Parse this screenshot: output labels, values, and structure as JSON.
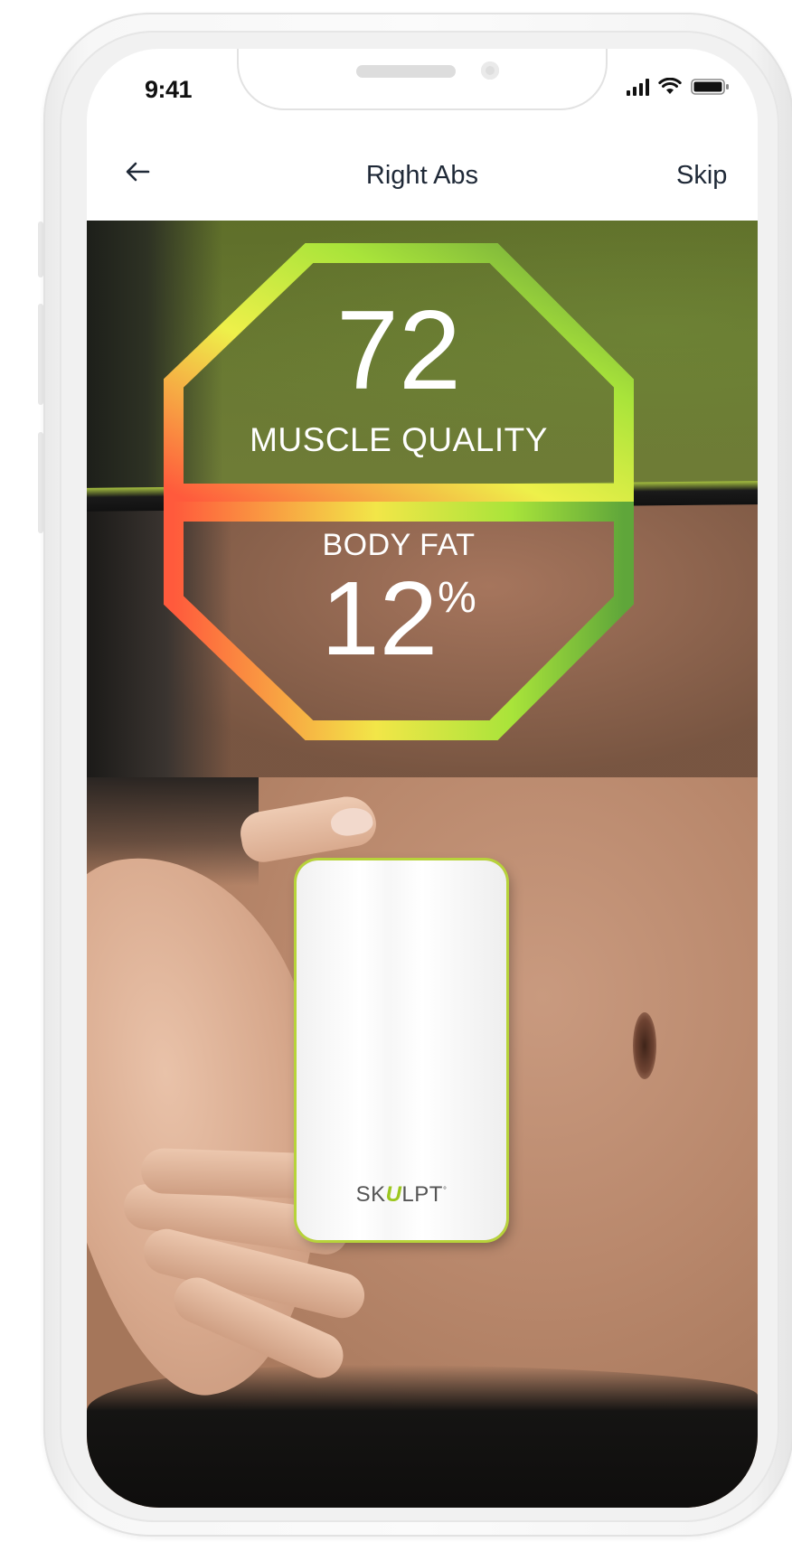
{
  "status_bar": {
    "time": "9:41"
  },
  "nav": {
    "back_icon": "arrow-left-icon",
    "title": "Right Abs",
    "skip_label": "Skip"
  },
  "metrics": {
    "muscle_quality": {
      "value": "72",
      "label": "MUSCLE QUALITY"
    },
    "body_fat": {
      "label": "BODY FAT",
      "value": "12",
      "unit": "%"
    }
  },
  "device": {
    "brand_prefix": "SK",
    "brand_u": "U",
    "brand_suffix": "LPT",
    "brand_mark": "°"
  },
  "colors": {
    "gauge_red": "#ff5a3c",
    "gauge_yellow": "#eef04a",
    "gauge_green": "#a9e43a",
    "accent_green": "#b7d33a"
  }
}
